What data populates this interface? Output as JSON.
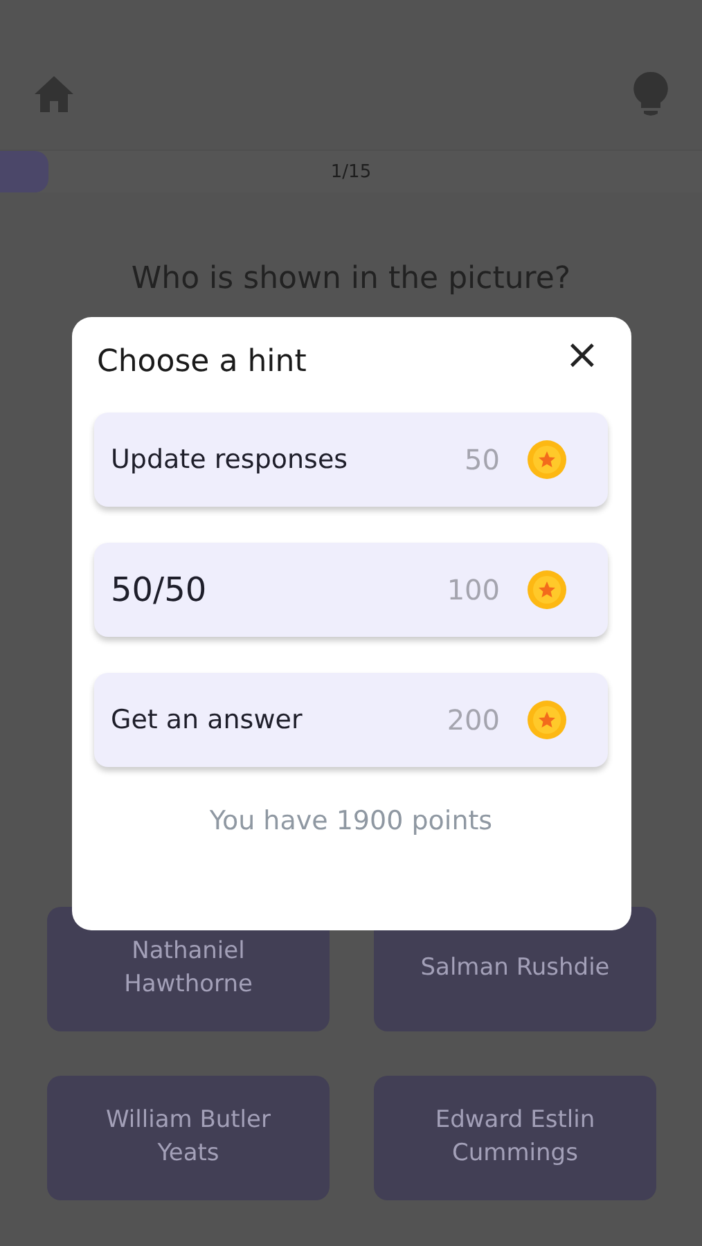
{
  "progress": {
    "label": "1/15",
    "level": 0.07
  },
  "question": "Who is shown in the picture?",
  "answers": [
    {
      "label": "Nathaniel Hawthorne"
    },
    {
      "label": "Salman Rushdie"
    },
    {
      "label": "William Butler Yeats"
    },
    {
      "label": "Edward Estlin Cummings"
    }
  ],
  "hint_dialog": {
    "title": "Choose a hint",
    "close": "×",
    "hints": [
      {
        "label": "Update responses",
        "cost": "50",
        "kind": "text"
      },
      {
        "label": "50/50",
        "cost": "100",
        "kind": "large"
      },
      {
        "label": "Get an answer",
        "cost": "200",
        "kind": "text"
      }
    ],
    "footer": "You have 1900 points"
  }
}
